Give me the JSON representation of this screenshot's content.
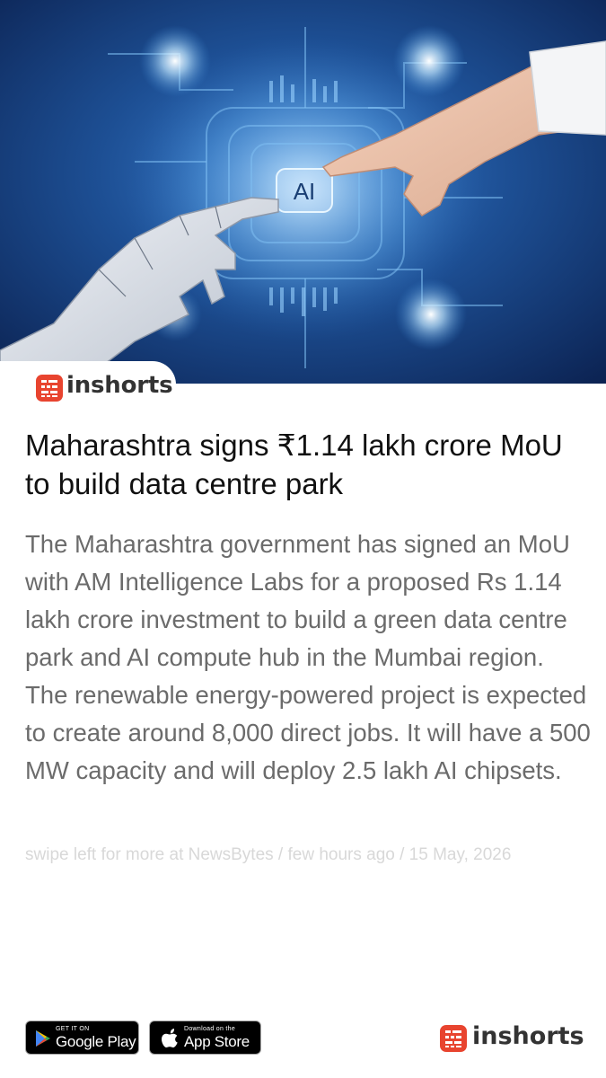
{
  "brand": {
    "name": "inshorts",
    "accent": "#e8442f"
  },
  "hero": {
    "chip_label": "AI"
  },
  "article": {
    "headline": "Maharashtra signs ₹1.14 lakh crore MoU to build data centre park",
    "body": "The Maharashtra government has signed an MoU with AM Intelligence Labs for a proposed Rs 1.14 lakh crore investment to build a green data centre park and AI compute hub in the Mumbai region. The renewable energy-powered project is expected to create around 8,000 direct jobs. It will have a 500 MW capacity and will deploy 2.5 lakh AI chipsets.",
    "footer": "swipe left for more at NewsBytes / few hours ago / 15 May, 2026"
  },
  "store_badges": {
    "google_play": {
      "small": "GET IT ON",
      "big": "Google Play"
    },
    "app_store": {
      "small": "Download on the",
      "big": "App Store"
    }
  }
}
